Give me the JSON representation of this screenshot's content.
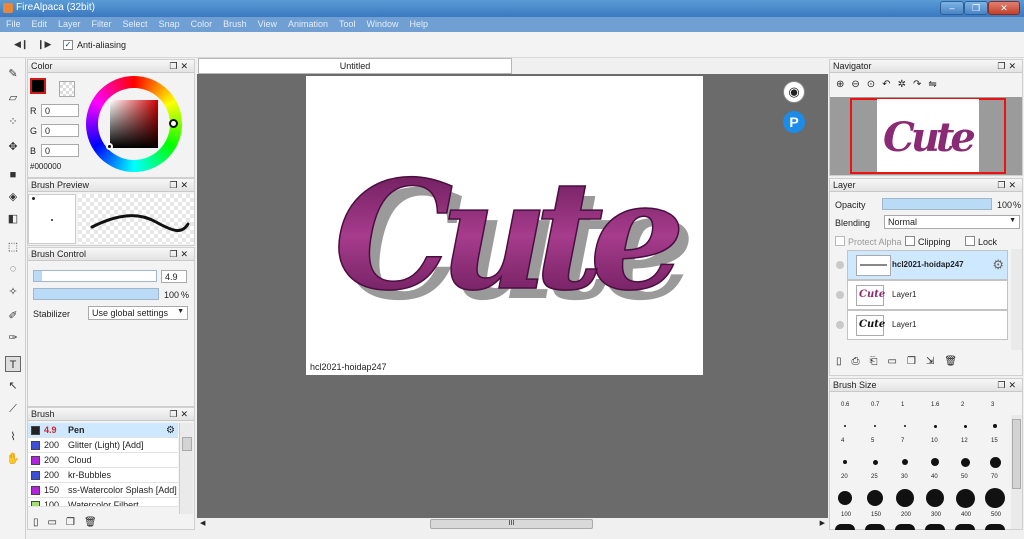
{
  "window": {
    "title": "FireAlpaca (32bit)",
    "buttons": [
      "–",
      "❐",
      "✕"
    ]
  },
  "menu": [
    "File",
    "Edit",
    "Layer",
    "Filter",
    "Select",
    "Snap",
    "Color",
    "Brush",
    "View",
    "Animation",
    "Tool",
    "Window",
    "Help"
  ],
  "toolbar": {
    "anti_aliasing_label": "Anti-aliasing",
    "anti_aliasing_checked": true
  },
  "color_panel": {
    "title": "Color",
    "r_label": "R",
    "g_label": "G",
    "b_label": "B",
    "r": "0",
    "g": "0",
    "b": "0",
    "hex": "#000000"
  },
  "brush_preview": {
    "title": "Brush Preview"
  },
  "brush_control": {
    "title": "Brush Control",
    "size_value": "4.9",
    "opacity_value": "100",
    "opacity_unit": "%",
    "stabilizer_label": "Stabilizer",
    "stabilizer_value": "Use global settings"
  },
  "brush_panel": {
    "title": "Brush",
    "items": [
      {
        "size": "4.9",
        "name": "Pen",
        "color": "#222222"
      },
      {
        "size": "200",
        "name": "Glitter (Light) [Add]",
        "color": "#3b4fd8"
      },
      {
        "size": "200",
        "name": "Cloud",
        "color": "#b025d9"
      },
      {
        "size": "200",
        "name": "kr-Bubbles",
        "color": "#3b4fd8"
      },
      {
        "size": "150",
        "name": "ss-Watercolor Splash [Add]",
        "color": "#b025d9"
      },
      {
        "size": "100",
        "name": "Watercolor Filbert",
        "color": "#9fe070"
      }
    ]
  },
  "canvas": {
    "tab_title": "Untitled",
    "art_text": "Cute",
    "watermark": "hcl2021-hoidap247",
    "art_color": "#7a1f62"
  },
  "scroll": {
    "grip": "III"
  },
  "navigator": {
    "title": "Navigator"
  },
  "layer_panel": {
    "title": "Layer",
    "opacity_label": "Opacity",
    "opacity_value": "100",
    "opacity_unit": "%",
    "blending_label": "Blending",
    "blending_value": "Normal",
    "protect_alpha_label": "Protect Alpha",
    "clipping_label": "Clipping",
    "lock_label": "Lock",
    "layers": [
      {
        "name": "hcl2021-hoidap247",
        "thumb": ""
      },
      {
        "name": "Layer1",
        "thumb": "Cute"
      },
      {
        "name": "Layer1",
        "thumb": "Cute"
      }
    ]
  },
  "brush_size_panel": {
    "title": "Brush Size",
    "row1": [
      "0.6",
      "0.7",
      "1",
      "1.6",
      "2",
      "3"
    ],
    "row2": [
      "4",
      "5",
      "7",
      "10",
      "12",
      "15"
    ],
    "row3": [
      "20",
      "25",
      "30",
      "40",
      "50",
      "70"
    ],
    "row4": [
      "100",
      "150",
      "200",
      "300",
      "400",
      "500"
    ]
  },
  "floating_icons": {
    "alpaca": "alpaca-icon",
    "pixiv": "P"
  }
}
